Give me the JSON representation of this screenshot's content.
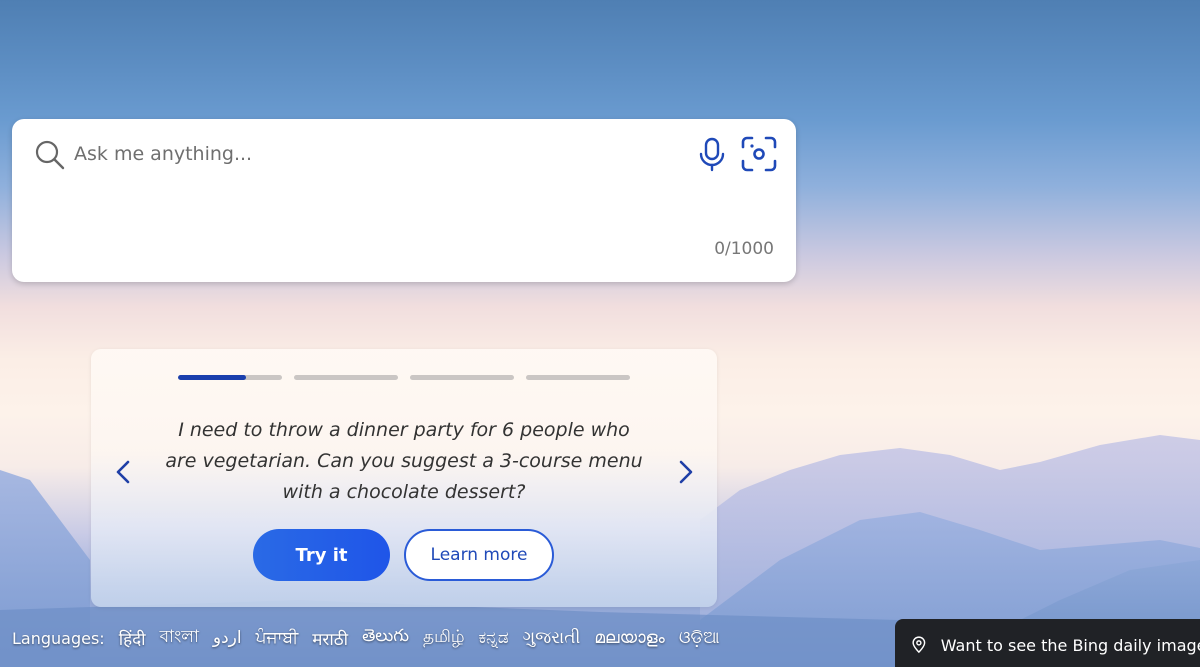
{
  "search": {
    "placeholder": "Ask me anything...",
    "value": "",
    "char_count": "0/1000",
    "mic_icon": "microphone-icon",
    "visual_search_icon": "visual-search-icon",
    "search_icon": "search-icon"
  },
  "suggestion_card": {
    "total_slides": 4,
    "current_slide": 1,
    "current_slide_progress": 0.65,
    "prompt": "I need to throw a dinner party for 6 people who are vegetarian. Can you suggest a 3-course menu with a chocolate dessert?",
    "prev_icon": "chevron-left-icon",
    "next_icon": "chevron-right-icon",
    "try_label": "Try it",
    "learn_label": "Learn more"
  },
  "languages": {
    "label": "Languages:",
    "items": [
      "हिंदी",
      "বাংলা",
      "اردو",
      "ਪੰਜਾਬੀ",
      "मराठी",
      "తెలుగు",
      "தமிழ்",
      "ಕನ್ನಡ",
      "ગુજરાતી",
      "മലയാളം",
      "ଓଡ଼ିଆ"
    ]
  },
  "daily_image": {
    "icon": "location-pin-icon",
    "text": "Want to see the Bing daily image?"
  },
  "colors": {
    "accent": "#1f55e8",
    "progress_active": "#1a3fad",
    "progress_inactive": "#cac6c4",
    "icon_blue": "#1f49b8"
  }
}
